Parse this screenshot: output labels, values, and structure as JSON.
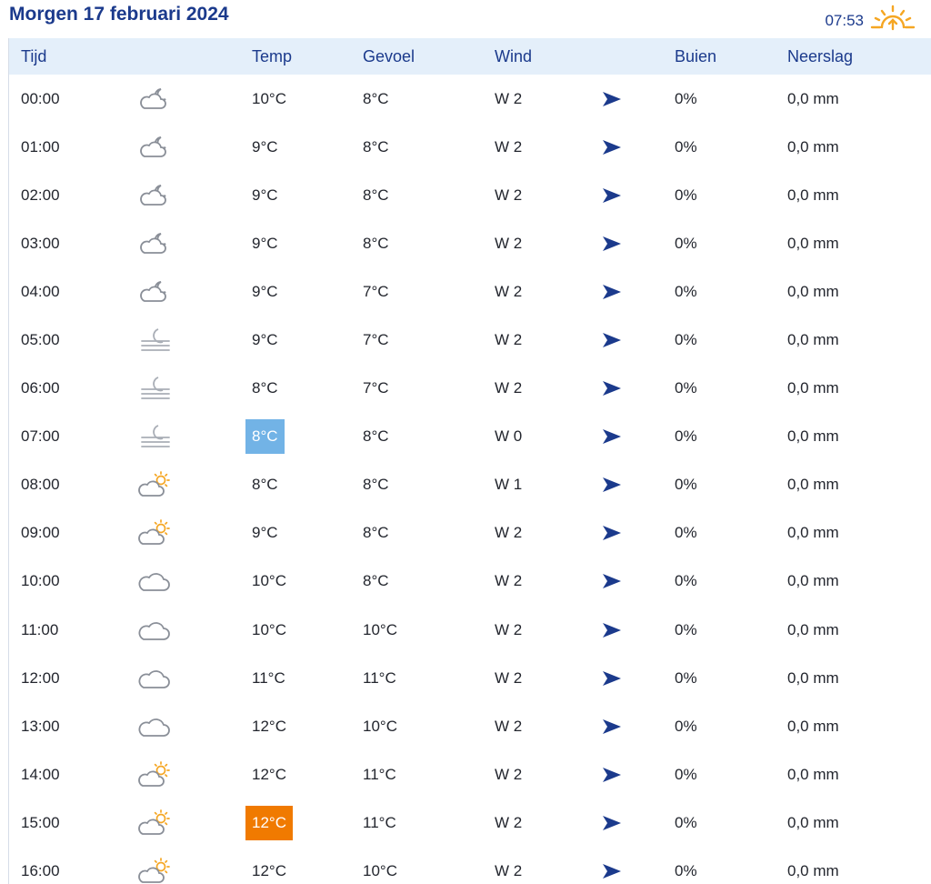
{
  "header": {
    "title": "Morgen 17 februari 2024",
    "sunrise_time": "07:53",
    "sunrise_icon": "sunrise-icon",
    "accent_color": "#1b3a8c",
    "sun_color": "#f5a623"
  },
  "columns": {
    "time": "Tijd",
    "temp": "Temp",
    "feel": "Gevoel",
    "wind": "Wind",
    "showers": "Buien",
    "precip": "Neerslag"
  },
  "highlight_colors": {
    "current": "#72b3e6",
    "max": "#f07a00"
  },
  "rows": [
    {
      "time": "00:00",
      "icon": "partly-cloudy-night-icon",
      "temp": "10°C",
      "feel": "8°C",
      "wind": "W 2",
      "showers": "0%",
      "precip": "0,0 mm",
      "highlight": ""
    },
    {
      "time": "01:00",
      "icon": "partly-cloudy-night-icon",
      "temp": "9°C",
      "feel": "8°C",
      "wind": "W 2",
      "showers": "0%",
      "precip": "0,0 mm",
      "highlight": ""
    },
    {
      "time": "02:00",
      "icon": "partly-cloudy-night-icon",
      "temp": "9°C",
      "feel": "8°C",
      "wind": "W 2",
      "showers": "0%",
      "precip": "0,0 mm",
      "highlight": ""
    },
    {
      "time": "03:00",
      "icon": "partly-cloudy-night-icon",
      "temp": "9°C",
      "feel": "8°C",
      "wind": "W 2",
      "showers": "0%",
      "precip": "0,0 mm",
      "highlight": ""
    },
    {
      "time": "04:00",
      "icon": "partly-cloudy-night-icon",
      "temp": "9°C",
      "feel": "7°C",
      "wind": "W 2",
      "showers": "0%",
      "precip": "0,0 mm",
      "highlight": ""
    },
    {
      "time": "05:00",
      "icon": "fog-night-icon",
      "temp": "9°C",
      "feel": "7°C",
      "wind": "W 2",
      "showers": "0%",
      "precip": "0,0 mm",
      "highlight": ""
    },
    {
      "time": "06:00",
      "icon": "fog-night-icon",
      "temp": "8°C",
      "feel": "7°C",
      "wind": "W 2",
      "showers": "0%",
      "precip": "0,0 mm",
      "highlight": ""
    },
    {
      "time": "07:00",
      "icon": "fog-night-icon",
      "temp": "8°C",
      "feel": "8°C",
      "wind": "W 0",
      "showers": "0%",
      "precip": "0,0 mm",
      "highlight": "current"
    },
    {
      "time": "08:00",
      "icon": "partly-cloudy-day-icon",
      "temp": "8°C",
      "feel": "8°C",
      "wind": "W 1",
      "showers": "0%",
      "precip": "0,0 mm",
      "highlight": ""
    },
    {
      "time": "09:00",
      "icon": "partly-cloudy-day-icon",
      "temp": "9°C",
      "feel": "8°C",
      "wind": "W 2",
      "showers": "0%",
      "precip": "0,0 mm",
      "highlight": ""
    },
    {
      "time": "10:00",
      "icon": "cloudy-icon",
      "temp": "10°C",
      "feel": "8°C",
      "wind": "W 2",
      "showers": "0%",
      "precip": "0,0 mm",
      "highlight": ""
    },
    {
      "time": "11:00",
      "icon": "cloudy-icon",
      "temp": "10°C",
      "feel": "10°C",
      "wind": "W 2",
      "showers": "0%",
      "precip": "0,0 mm",
      "highlight": ""
    },
    {
      "time": "12:00",
      "icon": "cloudy-icon",
      "temp": "11°C",
      "feel": "11°C",
      "wind": "W 2",
      "showers": "0%",
      "precip": "0,0 mm",
      "highlight": ""
    },
    {
      "time": "13:00",
      "icon": "cloudy-icon",
      "temp": "12°C",
      "feel": "10°C",
      "wind": "W 2",
      "showers": "0%",
      "precip": "0,0 mm",
      "highlight": ""
    },
    {
      "time": "14:00",
      "icon": "partly-cloudy-day-icon",
      "temp": "12°C",
      "feel": "11°C",
      "wind": "W 2",
      "showers": "0%",
      "precip": "0,0 mm",
      "highlight": ""
    },
    {
      "time": "15:00",
      "icon": "partly-cloudy-day-icon",
      "temp": "12°C",
      "feel": "11°C",
      "wind": "W 2",
      "showers": "0%",
      "precip": "0,0 mm",
      "highlight": "max"
    },
    {
      "time": "16:00",
      "icon": "partly-cloudy-day-icon",
      "temp": "12°C",
      "feel": "10°C",
      "wind": "W 2",
      "showers": "0%",
      "precip": "0,0 mm",
      "highlight": ""
    }
  ]
}
